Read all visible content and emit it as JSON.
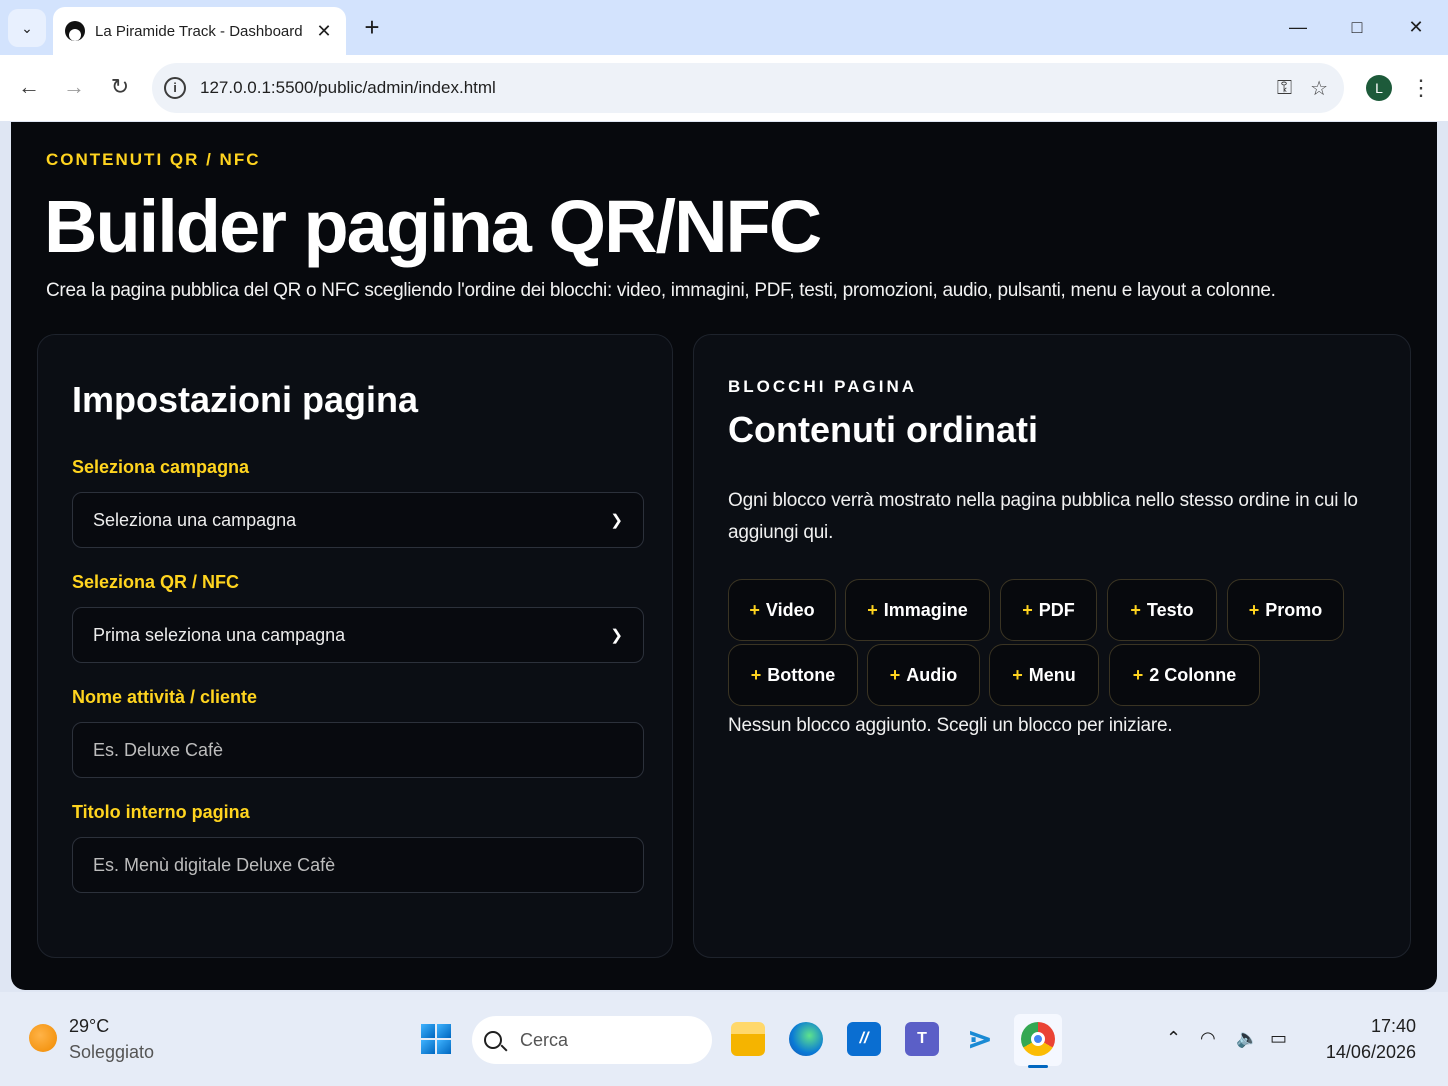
{
  "browser": {
    "tab_title": "La Piramide Track - Dashboard",
    "url": "127.0.0.1:5500/public/admin/index.html",
    "profile_initial": "L"
  },
  "page": {
    "eyebrow": "CONTENUTI QR / NFC",
    "title": "Builder pagina QR/NFC",
    "description": "Crea la pagina pubblica del QR o NFC scegliendo l'ordine dei blocchi: video, immagini, PDF, testi, promozioni, audio, pulsanti, menu e layout a colonne."
  },
  "settings": {
    "heading": "Impostazioni pagina",
    "campaign_label": "Seleziona campagna",
    "campaign_value": "Seleziona una campagna",
    "qr_label": "Seleziona QR / NFC",
    "qr_value": "Prima seleziona una campagna",
    "business_label": "Nome attività / cliente",
    "business_placeholder": "Es. Deluxe Cafè",
    "page_title_label": "Titolo interno pagina",
    "page_title_placeholder": "Es. Menù digitale Deluxe Cafè"
  },
  "blocks": {
    "eyebrow": "BLOCCHI PAGINA",
    "heading": "Contenuti ordinati",
    "description": "Ogni blocco verrà mostrato nella pagina pubblica nello stesso ordine in cui lo aggiungi qui.",
    "plus": "+",
    "buttons": [
      "Video",
      "Immagine",
      "PDF",
      "Testo",
      "Promo",
      "Bottone",
      "Audio",
      "Menu",
      "2 Colonne"
    ],
    "empty_message": "Nessun blocco aggiunto. Scegli un blocco per iniziare."
  },
  "taskbar": {
    "temperature": "29°C",
    "weather": "Soleggiato",
    "search_placeholder": "Cerca",
    "time": "17:40",
    "date": "14/06/2026"
  },
  "colors": {
    "accent": "#ffd41f",
    "page_bg": "#07090d",
    "card_bg": "#0b0e14"
  }
}
